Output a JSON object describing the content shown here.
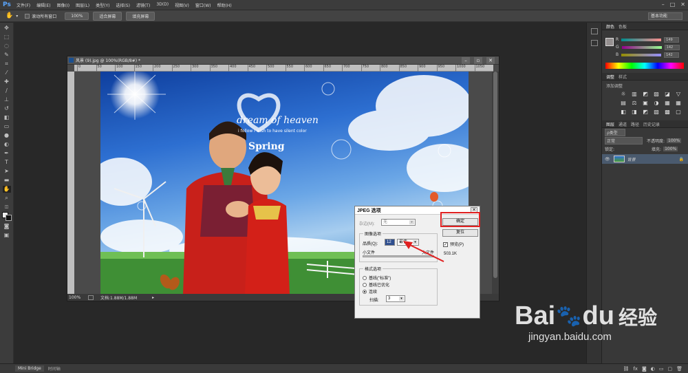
{
  "menu": {
    "logo": "Ps",
    "items": [
      "文件(F)",
      "编辑(E)",
      "图像(I)",
      "图层(L)",
      "类型(Y)",
      "选择(S)",
      "滤镜(T)",
      "3D(D)",
      "视图(V)",
      "窗口(W)",
      "帮助(H)"
    ],
    "win_controls": [
      "–",
      "□",
      "✕"
    ]
  },
  "options": {
    "scroll_all_label": "滚动所有窗口",
    "buttons": [
      "100%",
      "适合屏幕",
      "填充屏幕"
    ],
    "workspace": "基本功能"
  },
  "document": {
    "title": "风景 (9).jpg @ 100%(RGB/8#) *",
    "ruler_ticks": [
      "0",
      "50",
      "100",
      "150",
      "200",
      "250",
      "300",
      "350",
      "400",
      "450",
      "500",
      "550",
      "600",
      "650",
      "700",
      "750",
      "800",
      "850",
      "900",
      "950",
      "1000",
      "1050"
    ],
    "zoom": "100%",
    "doc_size": "文档:1.88M/1.88M",
    "photo_text": {
      "line1": "dream of heaven",
      "line2": "i follow i wish to have silent color",
      "line3": "Spring"
    }
  },
  "panels": {
    "color_tabs": [
      "颜色",
      "色板"
    ],
    "color_sliders": [
      {
        "label": "R",
        "value": "149"
      },
      {
        "label": "G",
        "value": "142"
      },
      {
        "label": "B",
        "value": "142"
      }
    ],
    "adjust_tabs": [
      "调整",
      "样式"
    ],
    "adjust_title": "添加调整",
    "adjust_icons": [
      "☼",
      "▥",
      "◩",
      "▨",
      "◪",
      "▽",
      "▤",
      "⚖",
      "▣",
      "◑",
      "▦",
      "▦",
      "◧",
      "◨",
      "◩",
      "▧",
      "▩",
      "▢"
    ],
    "layers_tabs": [
      "图层",
      "通道",
      "路径",
      "历史记录"
    ],
    "layers_filter": "ρ类型",
    "blend_mode": "正常",
    "opacity_label": "不透明度:",
    "opacity_value": "100%",
    "lock_label": "锁定:",
    "fill_label": "填充:",
    "fill_value": "100%",
    "layer_name": "背景"
  },
  "dialog": {
    "title": "JPEG 选项",
    "matte_label": "杂边(M):",
    "matte_value": "无",
    "image_options_legend": "图像选项",
    "quality_label": "品质(Q):",
    "quality_value": "12",
    "quality_preset": "最佳",
    "small_file_label": "小文件",
    "large_file_label": "大文件",
    "format_legend": "格式选项",
    "format_options": [
      "基线(\"标准\")",
      "基线已优化",
      "连续"
    ],
    "scan_label": "扫描:",
    "scan_value": "3",
    "ok_label": "确定",
    "reset_label": "复位",
    "preview_label": "预览(P)",
    "file_size": "503.1K"
  },
  "bottom": {
    "tabs": [
      "Mini Bridge",
      "时间轴"
    ]
  },
  "watermark": {
    "brand": "Bai",
    "brand2": "du",
    "cn": "经验",
    "url": "jingyan.baidu.com"
  },
  "colors": {
    "accent_red": "#e02020",
    "dialog_bg": "#f0f0f0",
    "ps_blue": "#5aa6ff"
  }
}
